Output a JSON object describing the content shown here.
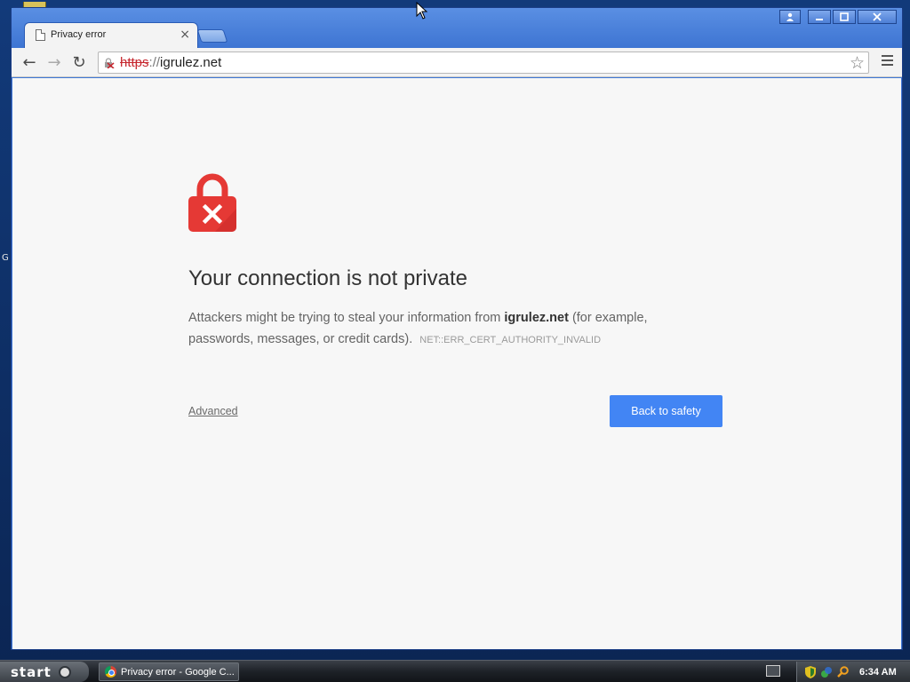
{
  "window": {
    "tab_title": "Privacy error",
    "tab_close_glyph": "×",
    "controls": {
      "user_glyph": "👤",
      "minimize_glyph": "▁",
      "maximize_glyph": "□",
      "close_glyph": "✕"
    }
  },
  "toolbar": {
    "back_glyph": "←",
    "forward_glyph": "→",
    "reload_glyph": "↻",
    "url_scheme": "https",
    "url_sep": "://",
    "url_host": "igrulez.net",
    "star_glyph": "☆"
  },
  "interstitial": {
    "heading": "Your connection is not private",
    "body_prefix": "Attackers might be trying to steal your information from ",
    "site": "igrulez.net",
    "body_suffix": " (for example, passwords, messages, or credit cards).",
    "error_code": "NET::ERR_CERT_AUTHORITY_INVALID",
    "advanced_label": "Advanced",
    "back_label": "Back to safety",
    "colors": {
      "lock_red": "#e53935",
      "button_blue": "#4285f4"
    }
  },
  "desktop": {
    "side_letter": "G"
  },
  "taskbar": {
    "start_label": "start",
    "task_label": "Privacy error - Google C...",
    "clock": "6:34 AM"
  }
}
